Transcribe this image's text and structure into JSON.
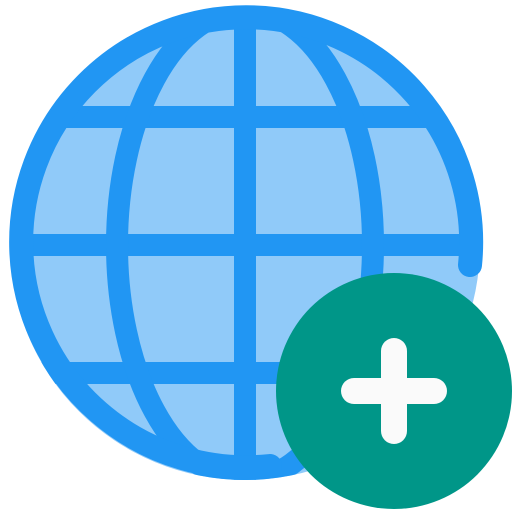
{
  "icon": {
    "name": "add-globe-icon",
    "globe_icon": "globe-icon",
    "badge_icon": "plus-icon"
  },
  "colors": {
    "globe_fill": "#90CAF9",
    "globe_stroke": "#2196F3",
    "badge_fill": "#009688",
    "plus": "#FAFAFA"
  }
}
